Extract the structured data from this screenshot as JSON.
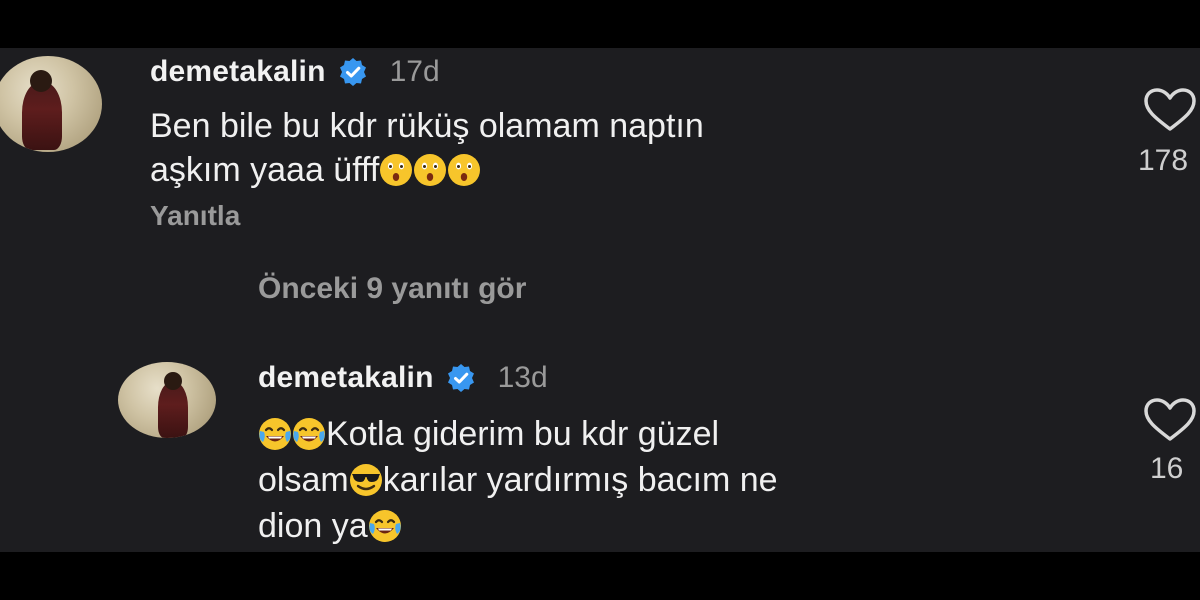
{
  "comments": [
    {
      "username": "demetakalin",
      "time": "17d",
      "line1": "Ben bile bu kdr rüküş olamam naptın",
      "line2": "aşkım yaaa üfff",
      "line2_emojis": [
        "astonished-face",
        "astonished-face",
        "astonished-face"
      ],
      "reply_label": "Yanıtla",
      "like_count": "178"
    },
    {
      "username": "demetakalin",
      "time": "13d",
      "line1_emojis_before": [
        "face-with-tears-of-joy",
        "face-with-tears-of-joy"
      ],
      "line1": "Kotla giderim bu kdr güzel",
      "line2_part1": "olsam",
      "line2_emoji": "smiling-face-with-sunglasses",
      "line2_part2": "karılar yardırmış bacım ne",
      "line3": "dion ya",
      "line3_emoji": "face-with-tears-of-joy",
      "like_count": "16"
    }
  ],
  "view_previous_replies": "Önceki 9 yanıtı gör",
  "colors": {
    "background": "#1d1d20",
    "text": "#f0f0f0",
    "muted": "#9a9a9a",
    "verified": "#3897f0"
  },
  "icons": [
    "verified-badge-icon",
    "heart-icon",
    "avatar"
  ]
}
